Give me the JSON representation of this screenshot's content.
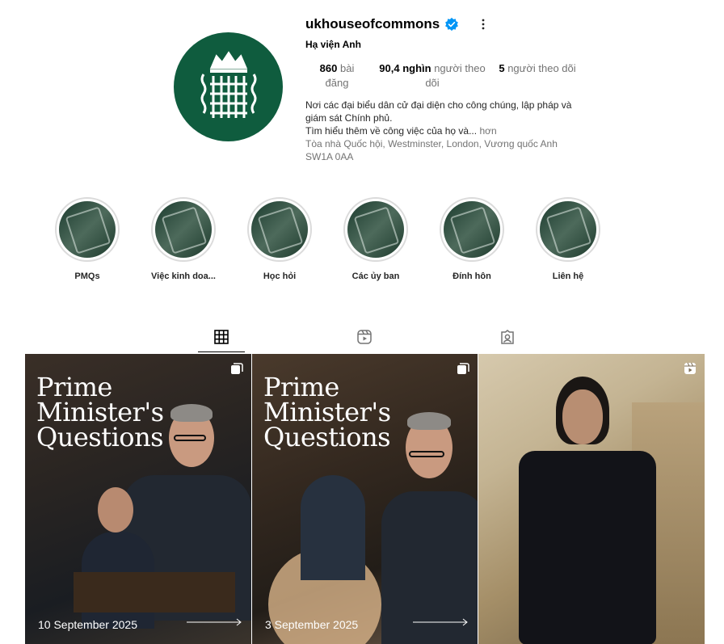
{
  "profile": {
    "username": "ukhouseofcommons",
    "full_name": "Hạ viện Anh",
    "stats": {
      "posts_value": "860",
      "posts_label": "bài đăng",
      "followers_value": "90,4 nghìn",
      "followers_label": "người theo dõi",
      "following_value": "5",
      "following_label": "người theo dõi"
    },
    "bio_line1": "Nơi các đại biểu dân cử đại diện cho công chúng, lập pháp và giám sát Chính phủ.",
    "bio_line2": "Tìm hiểu thêm về công việc của họ và...",
    "bio_more": "hơn",
    "address": "Tòa nhà Quốc hội, Westminster, London, Vương quốc Anh SW1A 0AA"
  },
  "highlights": [
    {
      "label": "PMQs",
      "icon": "pmqs-highlight-cover"
    },
    {
      "label": "Việc kinh doa...",
      "icon": "business-highlight-cover"
    },
    {
      "label": "Học hỏi",
      "icon": "learning-highlight-cover"
    },
    {
      "label": "Các ủy ban",
      "icon": "committees-highlight-cover"
    },
    {
      "label": "Đính hôn",
      "icon": "engagement-highlight-cover"
    },
    {
      "label": "Liên hệ",
      "icon": "contact-highlight-cover"
    }
  ],
  "tabs": [
    {
      "name": "posts",
      "icon": "grid-icon",
      "active": true
    },
    {
      "name": "reels",
      "icon": "reels-icon",
      "active": false
    },
    {
      "name": "tagged",
      "icon": "tagged-icon",
      "active": false
    }
  ],
  "posts": [
    {
      "title": "Prime\nMinister's\nQuestions",
      "date": "10 September 2025",
      "badge": "carousel-icon"
    },
    {
      "title": "Prime\nMinister's\nQuestions",
      "date": "3 September 2025",
      "badge": "carousel-icon"
    },
    {
      "title": "",
      "date": "",
      "badge": "reel-icon"
    }
  ],
  "colors": {
    "brand_green": "#0f5c3e",
    "verified_blue": "#0095f6",
    "muted_text": "#737373"
  }
}
